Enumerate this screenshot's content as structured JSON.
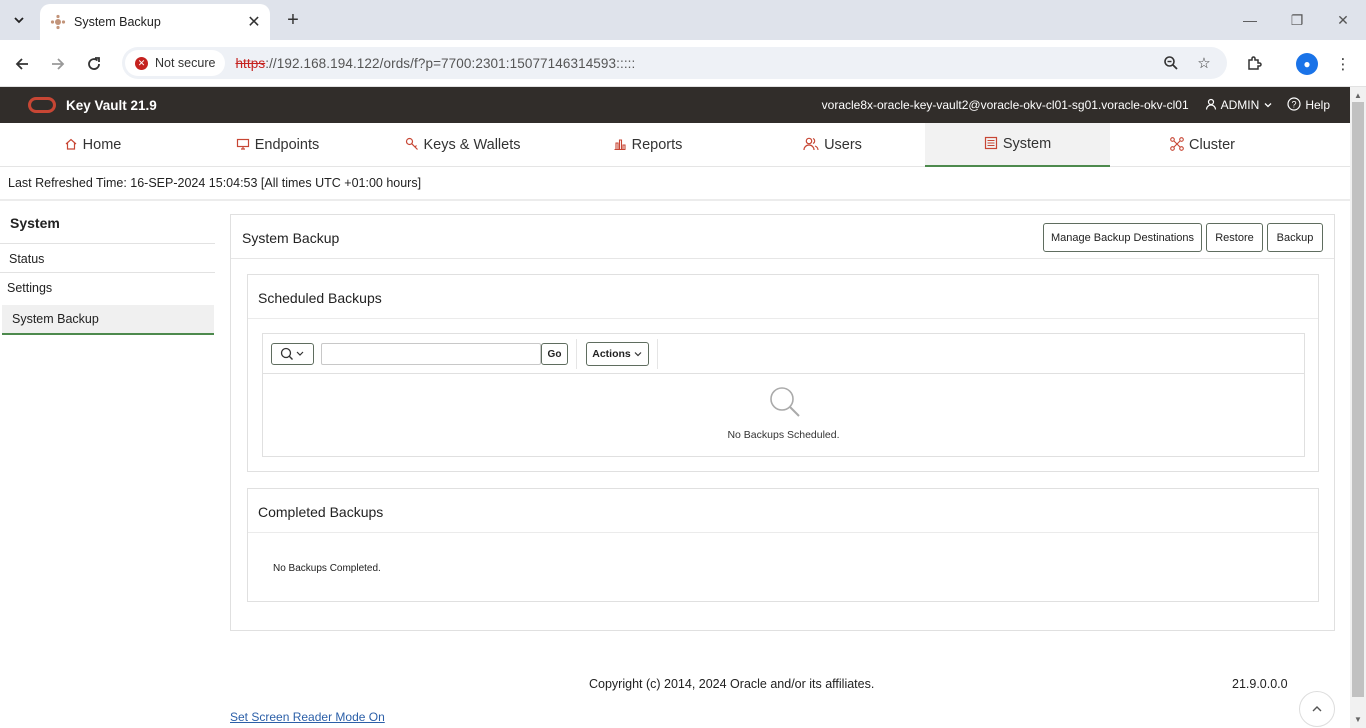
{
  "browser": {
    "tab_title": "System Backup",
    "security_label": "Not secure",
    "url_scheme": "https",
    "url_rest": "://192.168.194.122/ords/f?p=7700:2301:15077146314593:::::"
  },
  "header": {
    "app_title": "Key Vault 21.9",
    "user_path": "voracle8x-oracle-key-vault2@voracle-okv-cl01-sg01.voracle-okv-cl01",
    "admin_label": "ADMIN",
    "help_label": "Help"
  },
  "nav": {
    "tabs": [
      {
        "label": "Home",
        "icon": "home-icon"
      },
      {
        "label": "Endpoints",
        "icon": "monitor-icon"
      },
      {
        "label": "Keys & Wallets",
        "icon": "key-icon"
      },
      {
        "label": "Reports",
        "icon": "bar-chart-icon"
      },
      {
        "label": "Users",
        "icon": "users-icon"
      },
      {
        "label": "System",
        "icon": "system-icon"
      },
      {
        "label": "Cluster",
        "icon": "cluster-icon"
      }
    ],
    "active": "System"
  },
  "refresh_text": "Last Refreshed Time: 16-SEP-2024 15:04:53 [All times UTC +01:00 hours]",
  "sidebar": {
    "title": "System",
    "items": [
      {
        "label": "Status"
      },
      {
        "label": "Settings"
      },
      {
        "label": "System Backup"
      }
    ]
  },
  "region": {
    "title": "System Backup",
    "buttons": {
      "manage": "Manage Backup Destinations",
      "restore": "Restore",
      "backup": "Backup"
    }
  },
  "scheduled": {
    "title": "Scheduled Backups",
    "go_label": "Go",
    "actions_label": "Actions",
    "empty_message": "No Backups Scheduled."
  },
  "completed": {
    "title": "Completed Backups",
    "empty_message": "No Backups Completed."
  },
  "footer": {
    "copyright": "Copyright (c) 2014, 2024 Oracle and/or its affiliates.",
    "version": "21.9.0.0.0",
    "screen_reader_link": "Set Screen Reader Mode On"
  },
  "colors": {
    "oracle_red": "#c74634",
    "header_bg": "#312d2a",
    "active_underline": "#4d8a4d"
  }
}
